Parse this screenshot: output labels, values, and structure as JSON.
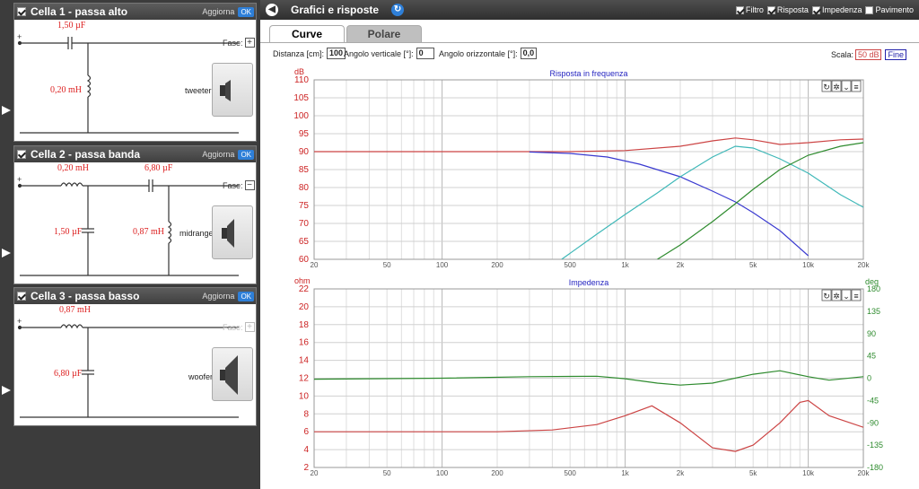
{
  "cells": [
    {
      "title": "Cella 1 - passa alto",
      "update_label": "Aggiorna",
      "ok_label": "OK",
      "fase_label": "Fase:",
      "fase_symbol": "+",
      "components": {
        "cap": "1,50 µF",
        "ind": "0,20 mH"
      },
      "speaker": "tweeter"
    },
    {
      "title": "Cella 2 - passa banda",
      "update_label": "Aggiorna",
      "ok_label": "OK",
      "fase_label": "Fase:",
      "fase_symbol": "−",
      "components": {
        "ind_series": "0,20 mH",
        "cap_series": "6,80 µF",
        "cap_shunt": "1,50 µF",
        "ind_shunt": "0,87 mH"
      },
      "speaker": "midrange"
    },
    {
      "title": "Cella 3 - passa basso",
      "update_label": "Aggiorna",
      "ok_label": "OK",
      "fase_label": "Fase:",
      "fase_symbol": "+",
      "components": {
        "ind": "0,87 mH",
        "cap": "6,80 µF"
      },
      "speaker": "woofer"
    }
  ],
  "panel": {
    "title": "Grafici e risposte",
    "options": [
      {
        "label": "Filtro",
        "checked": true
      },
      {
        "label": "Risposta",
        "checked": true
      },
      {
        "label": "Impedenza",
        "checked": true
      },
      {
        "label": "Pavimento",
        "checked": false
      }
    ],
    "tabs": [
      "Curve",
      "Polare"
    ],
    "distance_label": "Distanza [cm]:",
    "distance_value": "100",
    "vert_angle_label": "Angolo verticale [°]:",
    "vert_angle_value": "0",
    "horiz_angle_label": "Angolo orizzontale [°]:",
    "horiz_angle_value": "0,0",
    "scale_label": "Scala:",
    "scale_value": "50 dB",
    "fine_label": "Fine"
  },
  "chart_data": [
    {
      "type": "line",
      "title": "Risposta in frequenza",
      "ylabel": "dB",
      "xscale": "log",
      "xlim": [
        20,
        20000
      ],
      "ylim": [
        60,
        110
      ],
      "xticks": [
        "20",
        "50",
        "100",
        "200",
        "500",
        "1k",
        "2k",
        "5k",
        "10k",
        "20k"
      ],
      "xtick_values": [
        20,
        50,
        100,
        200,
        500,
        1000,
        2000,
        5000,
        10000,
        20000
      ],
      "yticks": [
        60,
        65,
        70,
        75,
        80,
        85,
        90,
        95,
        100,
        105,
        110
      ],
      "grid": true,
      "series": [
        {
          "color": "#cc4444",
          "x": [
            20,
            100,
            500,
            1000,
            2000,
            3000,
            4000,
            5000,
            7000,
            10000,
            15000,
            20000
          ],
          "y": [
            90,
            90,
            90,
            90.3,
            91.5,
            93,
            93.8,
            93.3,
            92,
            92.5,
            93.3,
            93.5
          ]
        },
        {
          "color": "#3a3ad0",
          "x": [
            300,
            500,
            800,
            1200,
            2000,
            3000,
            4000,
            5000,
            7000,
            10000
          ],
          "y": [
            89.9,
            89.5,
            88.5,
            86.5,
            83,
            79,
            76,
            73,
            68,
            61
          ]
        },
        {
          "color": "#3fb8b8",
          "x": [
            450,
            700,
            1000,
            1500,
            2000,
            3000,
            4000,
            5000,
            7000,
            10000,
            15000,
            20000
          ],
          "y": [
            60,
            67,
            72.5,
            78.5,
            83,
            88.5,
            91.5,
            91,
            88,
            84,
            78,
            74.5
          ]
        },
        {
          "color": "#2e8b2e",
          "x": [
            1500,
            2000,
            3000,
            4000,
            5000,
            7000,
            10000,
            15000,
            20000
          ],
          "y": [
            60,
            64,
            70.5,
            75.5,
            79.5,
            85,
            89,
            91.5,
            92.5
          ]
        }
      ]
    },
    {
      "type": "line",
      "title": "Impedenza",
      "ylabel": "ohm",
      "y2label": "deg",
      "xscale": "log",
      "xlim": [
        20,
        20000
      ],
      "ylim": [
        2,
        22
      ],
      "y2lim": [
        -180,
        180
      ],
      "xticks": [
        "20",
        "50",
        "100",
        "200",
        "500",
        "1k",
        "2k",
        "5k",
        "10k",
        "20k"
      ],
      "xtick_values": [
        20,
        50,
        100,
        200,
        500,
        1000,
        2000,
        5000,
        10000,
        20000
      ],
      "yticks": [
        2,
        4,
        6,
        8,
        10,
        12,
        14,
        16,
        18,
        20,
        22
      ],
      "y2ticks": [
        -180,
        -135,
        -90,
        -45,
        0,
        45,
        90,
        135,
        180
      ],
      "grid": true,
      "series": [
        {
          "color": "#cc4444",
          "axis": "left",
          "x": [
            20,
            200,
            400,
            700,
            1000,
            1400,
            2000,
            3000,
            4000,
            5000,
            7000,
            9000,
            10000,
            13000,
            20000
          ],
          "y": [
            6,
            6,
            6.2,
            6.8,
            7.8,
            8.9,
            7,
            4.2,
            3.8,
            4.5,
            7,
            9.3,
            9.5,
            7.8,
            6.5
          ]
        },
        {
          "color": "#2e8b2e",
          "axis": "right",
          "x": [
            20,
            100,
            300,
            700,
            1000,
            1500,
            2000,
            3000,
            5000,
            7000,
            10000,
            13000,
            20000
          ],
          "y": [
            -2,
            0,
            3,
            4,
            -1,
            -10,
            -14,
            -10,
            8,
            15,
            3,
            -4,
            3
          ]
        }
      ]
    }
  ]
}
